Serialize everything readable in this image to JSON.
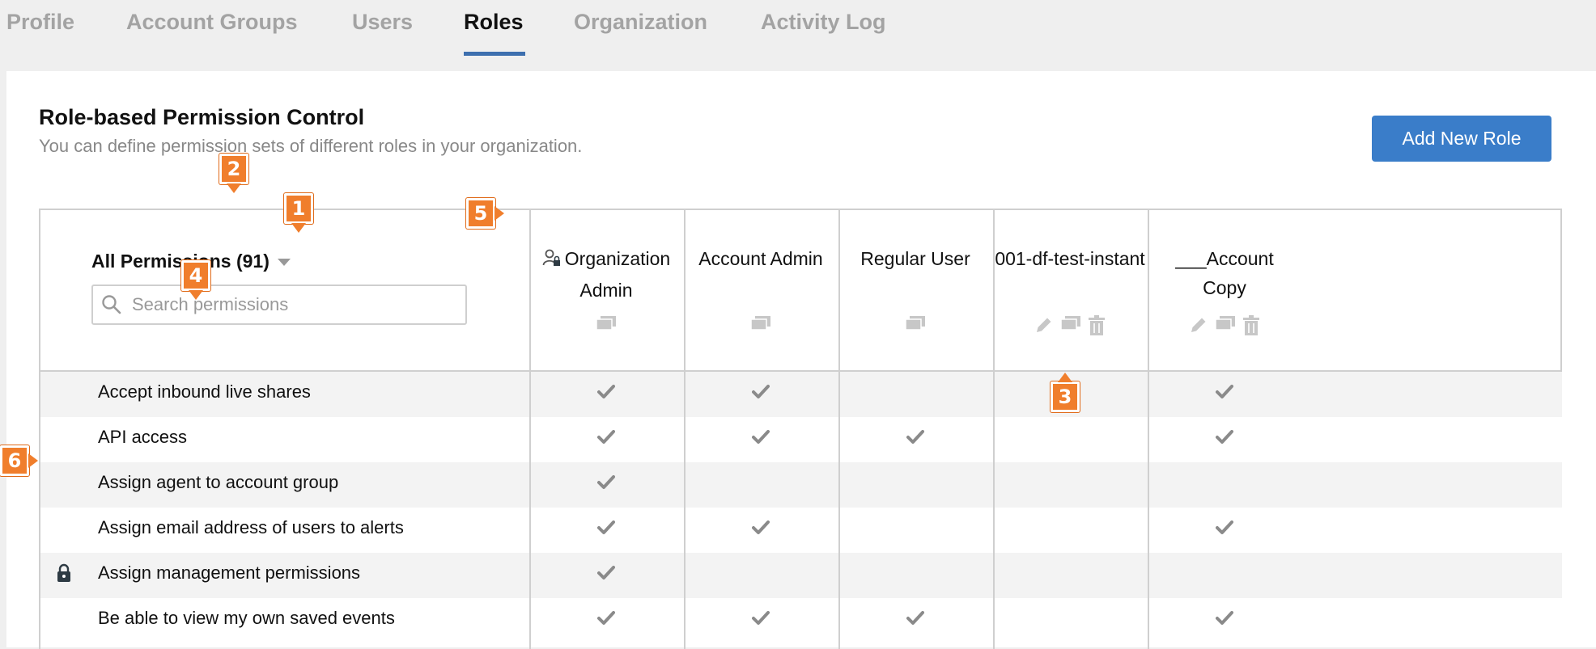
{
  "tabs": [
    {
      "label": "Profile"
    },
    {
      "label": "Account Groups"
    },
    {
      "label": "Users"
    },
    {
      "label": "Roles"
    },
    {
      "label": "Organization"
    },
    {
      "label": "Activity Log"
    }
  ],
  "active_tab": "Roles",
  "header": {
    "title": "Role-based Permission Control",
    "subtitle": "You can define permission sets of different roles in your organization.",
    "add_button": "Add New Role"
  },
  "permissions_header": "All Permissions (91)",
  "search": {
    "placeholder": "Search permissions",
    "value": ""
  },
  "roles": [
    {
      "line1": "Organization",
      "line2": "Admin",
      "icons": [
        "copy-icon"
      ],
      "has_org_icon": true
    },
    {
      "line1": "Account Admin",
      "line2": "",
      "icons": [
        "copy-icon"
      ]
    },
    {
      "line1": "Regular User",
      "line2": "",
      "icons": [
        "copy-icon"
      ]
    },
    {
      "line1": "001-df-test-instant",
      "line2": "",
      "icons": [
        "pencil-icon",
        "copy-icon",
        "trash-icon"
      ]
    },
    {
      "line1": "___Account",
      "line2": "Copy",
      "icons": [
        "pencil-icon",
        "copy-icon",
        "trash-icon"
      ]
    }
  ],
  "rows": [
    {
      "label": "Accept inbound live shares",
      "locked": false,
      "checks": [
        true,
        true,
        false,
        false,
        true
      ]
    },
    {
      "label": "API access",
      "locked": false,
      "checks": [
        true,
        true,
        true,
        false,
        true
      ]
    },
    {
      "label": "Assign agent to account group",
      "locked": false,
      "checks": [
        true,
        false,
        false,
        false,
        false
      ]
    },
    {
      "label": "Assign email address of users to alerts",
      "locked": false,
      "checks": [
        true,
        true,
        false,
        false,
        true
      ]
    },
    {
      "label": "Assign management permissions",
      "locked": true,
      "checks": [
        true,
        false,
        false,
        false,
        false
      ]
    },
    {
      "label": "Be able to view my own saved events",
      "locked": false,
      "checks": [
        true,
        true,
        true,
        false,
        true
      ]
    }
  ],
  "callouts": [
    "1",
    "2",
    "3",
    "4",
    "5",
    "6"
  ],
  "colors": {
    "accent": "#3a7dc9",
    "tab_underline": "#3d6fae",
    "callout": "#f07e2c",
    "check": "#8a8a8a"
  }
}
